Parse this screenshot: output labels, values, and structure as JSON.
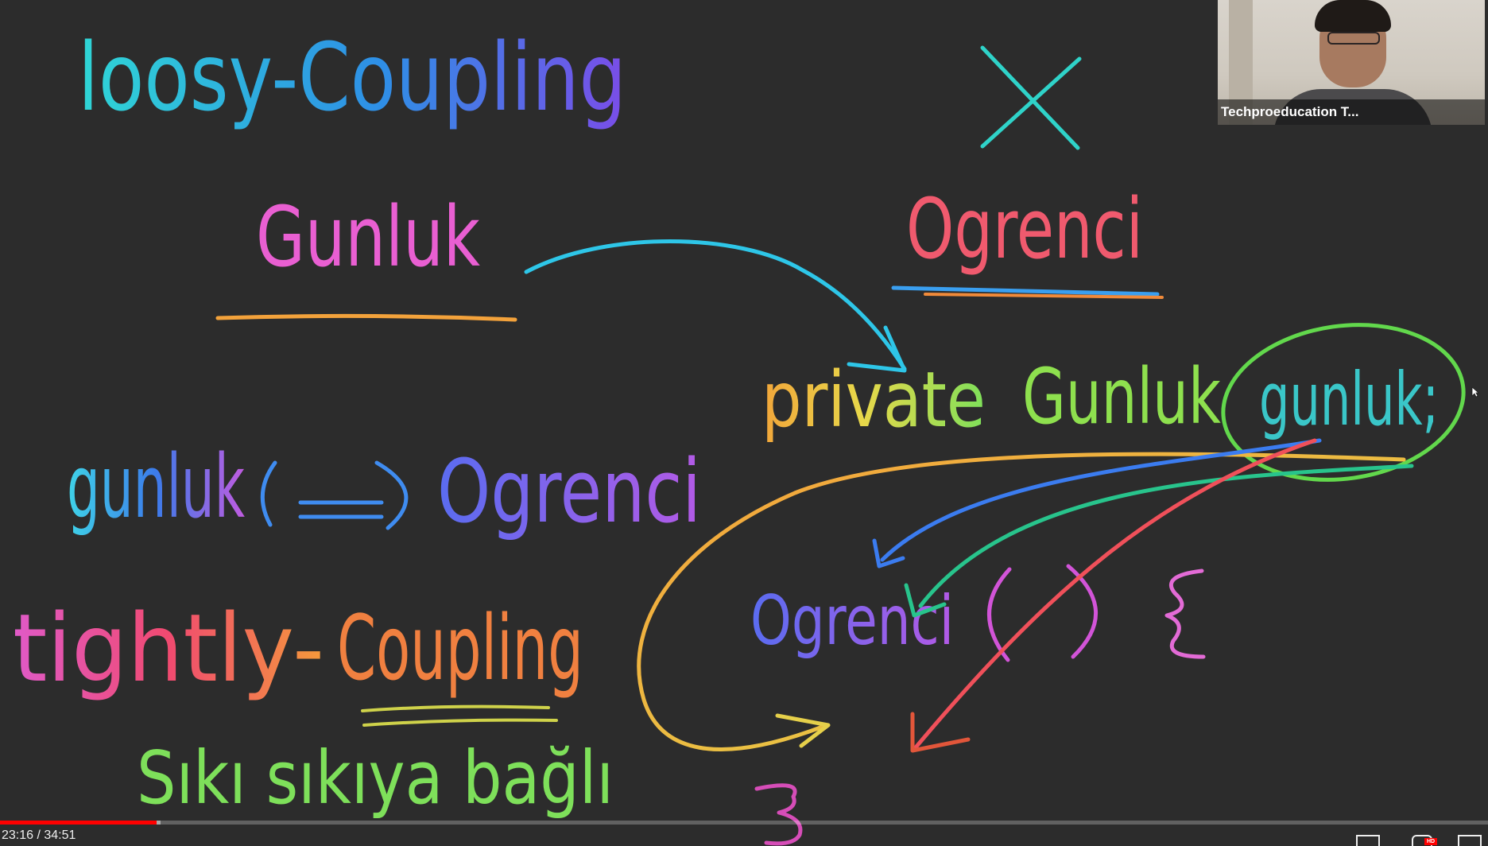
{
  "board": {
    "loosely_coupling": "loosy-Coupling",
    "gunluk_title": "Gunluk",
    "x_mark": "X",
    "ogrenci_title": "Ogrenci",
    "private_word": "private",
    "gunluk_type": "Gunluk",
    "gunluk_var": "gunluk;",
    "relation_left": "gunluk",
    "relation_arrow": "⟺",
    "relation_right": "Ogrenci",
    "tightly_word": "tightly-",
    "coupling_word": "Coupling",
    "constructor_name": "Ogrenci",
    "constructor_parens": "( )",
    "open_brace": "{",
    "close_brace": "}",
    "turkish_phrase": "Sıkı sıkıya bağlı"
  },
  "webcam": {
    "presenter_name": "Techproeducation T..."
  },
  "player": {
    "time": "23:16 / 34:51",
    "progress": 0.105,
    "buffered": 0.108,
    "hd_label": "HD"
  },
  "colors": {
    "background": "#2c2c2c",
    "progress_played": "#ff0000"
  },
  "icons": [
    "mouse-cursor-icon",
    "subtitles-icon",
    "settings-icon",
    "fullscreen-icon"
  ]
}
